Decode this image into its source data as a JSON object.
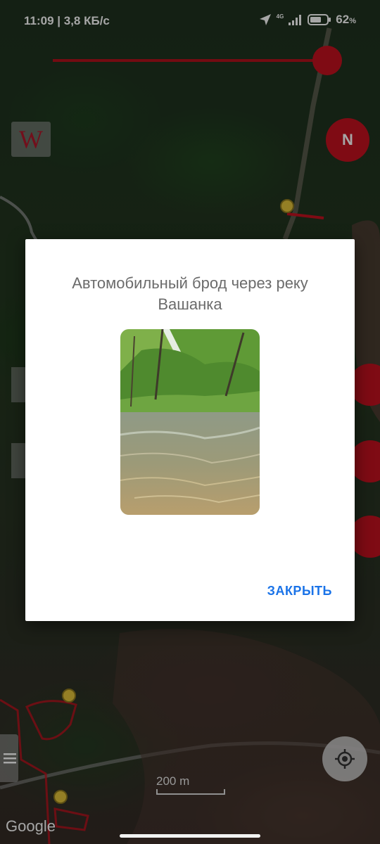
{
  "status_bar": {
    "time_speed": "11:09 | 3,8 КБ/с",
    "network": "4G",
    "battery_percent": "62",
    "battery_unit": "%"
  },
  "map": {
    "wikipedia_icon": "W",
    "compass_label": "N",
    "scale_label": "200 m",
    "attribution": "Google",
    "icons": [
      "location-arrow-icon",
      "signal-icon",
      "battery-icon",
      "wikipedia-icon",
      "compass-icon",
      "menu-icon",
      "crosshair-icon"
    ]
  },
  "dialog": {
    "title": "Автомобильный брод через реку Вашанка",
    "close_label": "ЗАКРЫТЬ"
  },
  "colors": {
    "accent_red": "#c4121f",
    "link_blue": "#1a73e8",
    "title_gray": "#6b6b6b"
  }
}
